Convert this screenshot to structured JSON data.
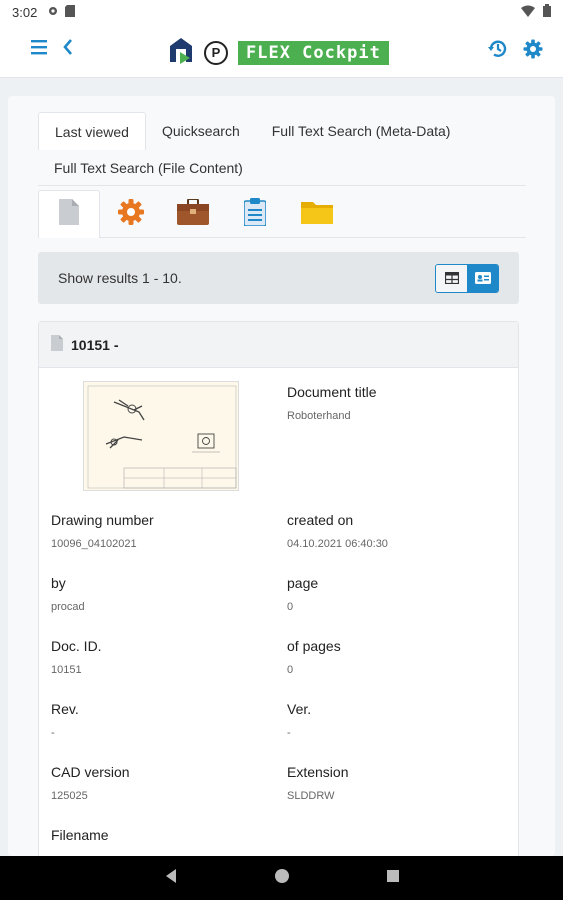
{
  "status": {
    "time": "3:02"
  },
  "brand": {
    "p_letter": "P",
    "label": "FLEX Cockpit"
  },
  "tabs": [
    "Last viewed",
    "Quicksearch",
    "Full Text Search (Meta-Data)"
  ],
  "tab2": "Full Text Search (File Content)",
  "results": {
    "summary": "Show results 1 - 10."
  },
  "document": {
    "header": "10151 -",
    "fields": {
      "title_label": "Document title",
      "title_value": "Roboterhand",
      "drawing_label": "Drawing number",
      "drawing_value": "10096_04102021",
      "created_label": "created on",
      "created_value": "04.10.2021 06:40:30",
      "by_label": "by",
      "by_value": "procad",
      "page_label": "page",
      "page_value": "0",
      "docid_label": "Doc. ID.",
      "docid_value": "10151",
      "ofpages_label": "of pages",
      "ofpages_value": "0",
      "rev_label": "Rev.",
      "rev_value": "-",
      "ver_label": "Ver.",
      "ver_value": "-",
      "cad_label": "CAD version",
      "cad_value": "125025",
      "ext_label": "Extension",
      "ext_value": "SLDDRW",
      "filename_label": "Filename"
    }
  },
  "colors": {
    "accent": "#1e88c8",
    "brand_green": "#4caf50",
    "gear_orange": "#e87722",
    "folder_yellow": "#f5c518"
  }
}
